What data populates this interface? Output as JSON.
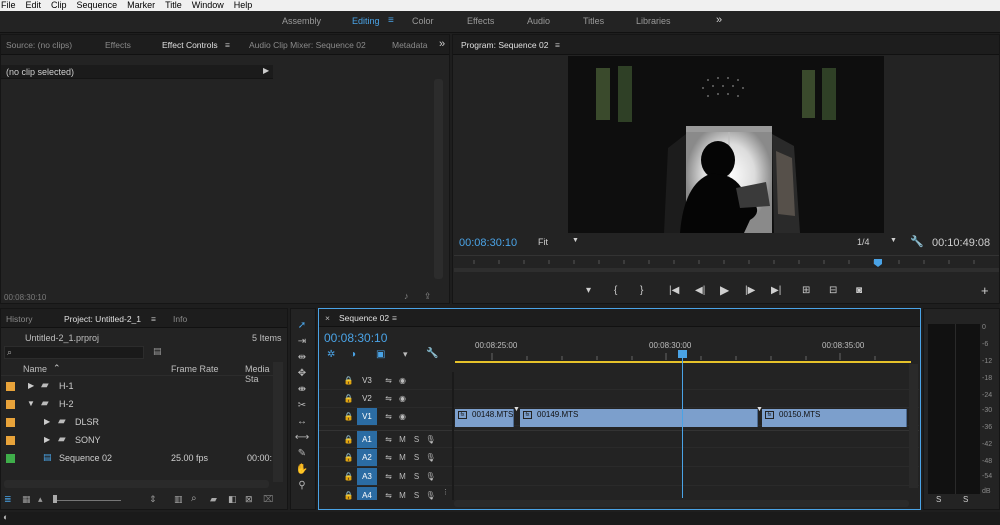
{
  "menu": [
    "File",
    "Edit",
    "Clip",
    "Sequence",
    "Marker",
    "Title",
    "Window",
    "Help"
  ],
  "workspaces": {
    "items": [
      "Assembly",
      "Editing",
      "Color",
      "Effects",
      "Audio",
      "Titles",
      "Libraries"
    ],
    "active": "Editing",
    "more": "»"
  },
  "source_panel": {
    "tabs": [
      "Source: (no clips)",
      "Effects",
      "Effect Controls",
      "Audio Clip Mixer: Sequence 02",
      "Metadata"
    ],
    "active_tab": "Effect Controls",
    "more": "»",
    "no_clip": "(no clip selected)",
    "timecode": "00:08:30:10"
  },
  "program": {
    "title": "Program: Sequence 02",
    "timecode": "00:08:30:10",
    "fit": "Fit",
    "resolution": "1/4",
    "duration": "00:10:49:08",
    "controls": [
      "marker-icon",
      "mark-in-icon",
      "mark-out-icon",
      "go-to-in-icon",
      "step-back-icon",
      "play-icon",
      "step-forward-icon",
      "go-to-out-icon",
      "lift-icon",
      "extract-icon",
      "export-frame-icon"
    ],
    "add": "+"
  },
  "project": {
    "tabs": [
      "History",
      "Project: Untitled-2_1",
      "Info"
    ],
    "active_tab": "Project: Untitled-2_1",
    "file": "Untitled-2_1.prproj",
    "count": "5 Items",
    "columns": [
      "Name",
      "Frame Rate",
      "Media Sta"
    ],
    "items": [
      {
        "name": "H-1",
        "frame_rate": "",
        "media_start": "",
        "color": "#e8a33a",
        "type": "folder",
        "indent": 0,
        "expanded": false
      },
      {
        "name": "H-2",
        "frame_rate": "",
        "media_start": "",
        "color": "#e8a33a",
        "type": "folder",
        "indent": 0,
        "expanded": true
      },
      {
        "name": "DLSR",
        "frame_rate": "",
        "media_start": "",
        "color": "#e8a33a",
        "type": "folder",
        "indent": 1,
        "expanded": false
      },
      {
        "name": "SONY",
        "frame_rate": "",
        "media_start": "",
        "color": "#e8a33a",
        "type": "folder",
        "indent": 1,
        "expanded": false
      },
      {
        "name": "Sequence 02",
        "frame_rate": "25.00 fps",
        "media_start": "00:00:",
        "color": "#3fae4a",
        "type": "sequence",
        "indent": 1,
        "expanded": false
      }
    ]
  },
  "timeline": {
    "tab": "Sequence 02",
    "timecode": "00:08:30:10",
    "ruler": [
      "00:08:25:00",
      "00:08:30:00",
      "00:08:35:00"
    ],
    "tracks": [
      {
        "id": "V3",
        "kind": "video",
        "targeted": false
      },
      {
        "id": "V2",
        "kind": "video",
        "targeted": false
      },
      {
        "id": "V1",
        "kind": "video",
        "targeted": true
      },
      {
        "id": "A1",
        "kind": "audio",
        "targeted": true
      },
      {
        "id": "A2",
        "kind": "audio",
        "targeted": true
      },
      {
        "id": "A3",
        "kind": "audio",
        "targeted": true
      },
      {
        "id": "A4",
        "kind": "audio",
        "targeted": true
      }
    ],
    "mute": "M",
    "solo": "S",
    "clips": [
      "00148.MTS",
      "00149.MTS",
      "00150.MTS"
    ]
  },
  "meters": {
    "scale": [
      "0",
      "-6",
      "-12",
      "-18",
      "-24",
      "-30",
      "-36",
      "-42",
      "-48",
      "-54",
      "dB"
    ],
    "solo": [
      "S",
      "S"
    ]
  },
  "colors": {
    "accent": "#4aa3e6",
    "playhead": "#4aa3e6",
    "clip": "#7c9fcc",
    "work_area": "#e6c22a"
  }
}
